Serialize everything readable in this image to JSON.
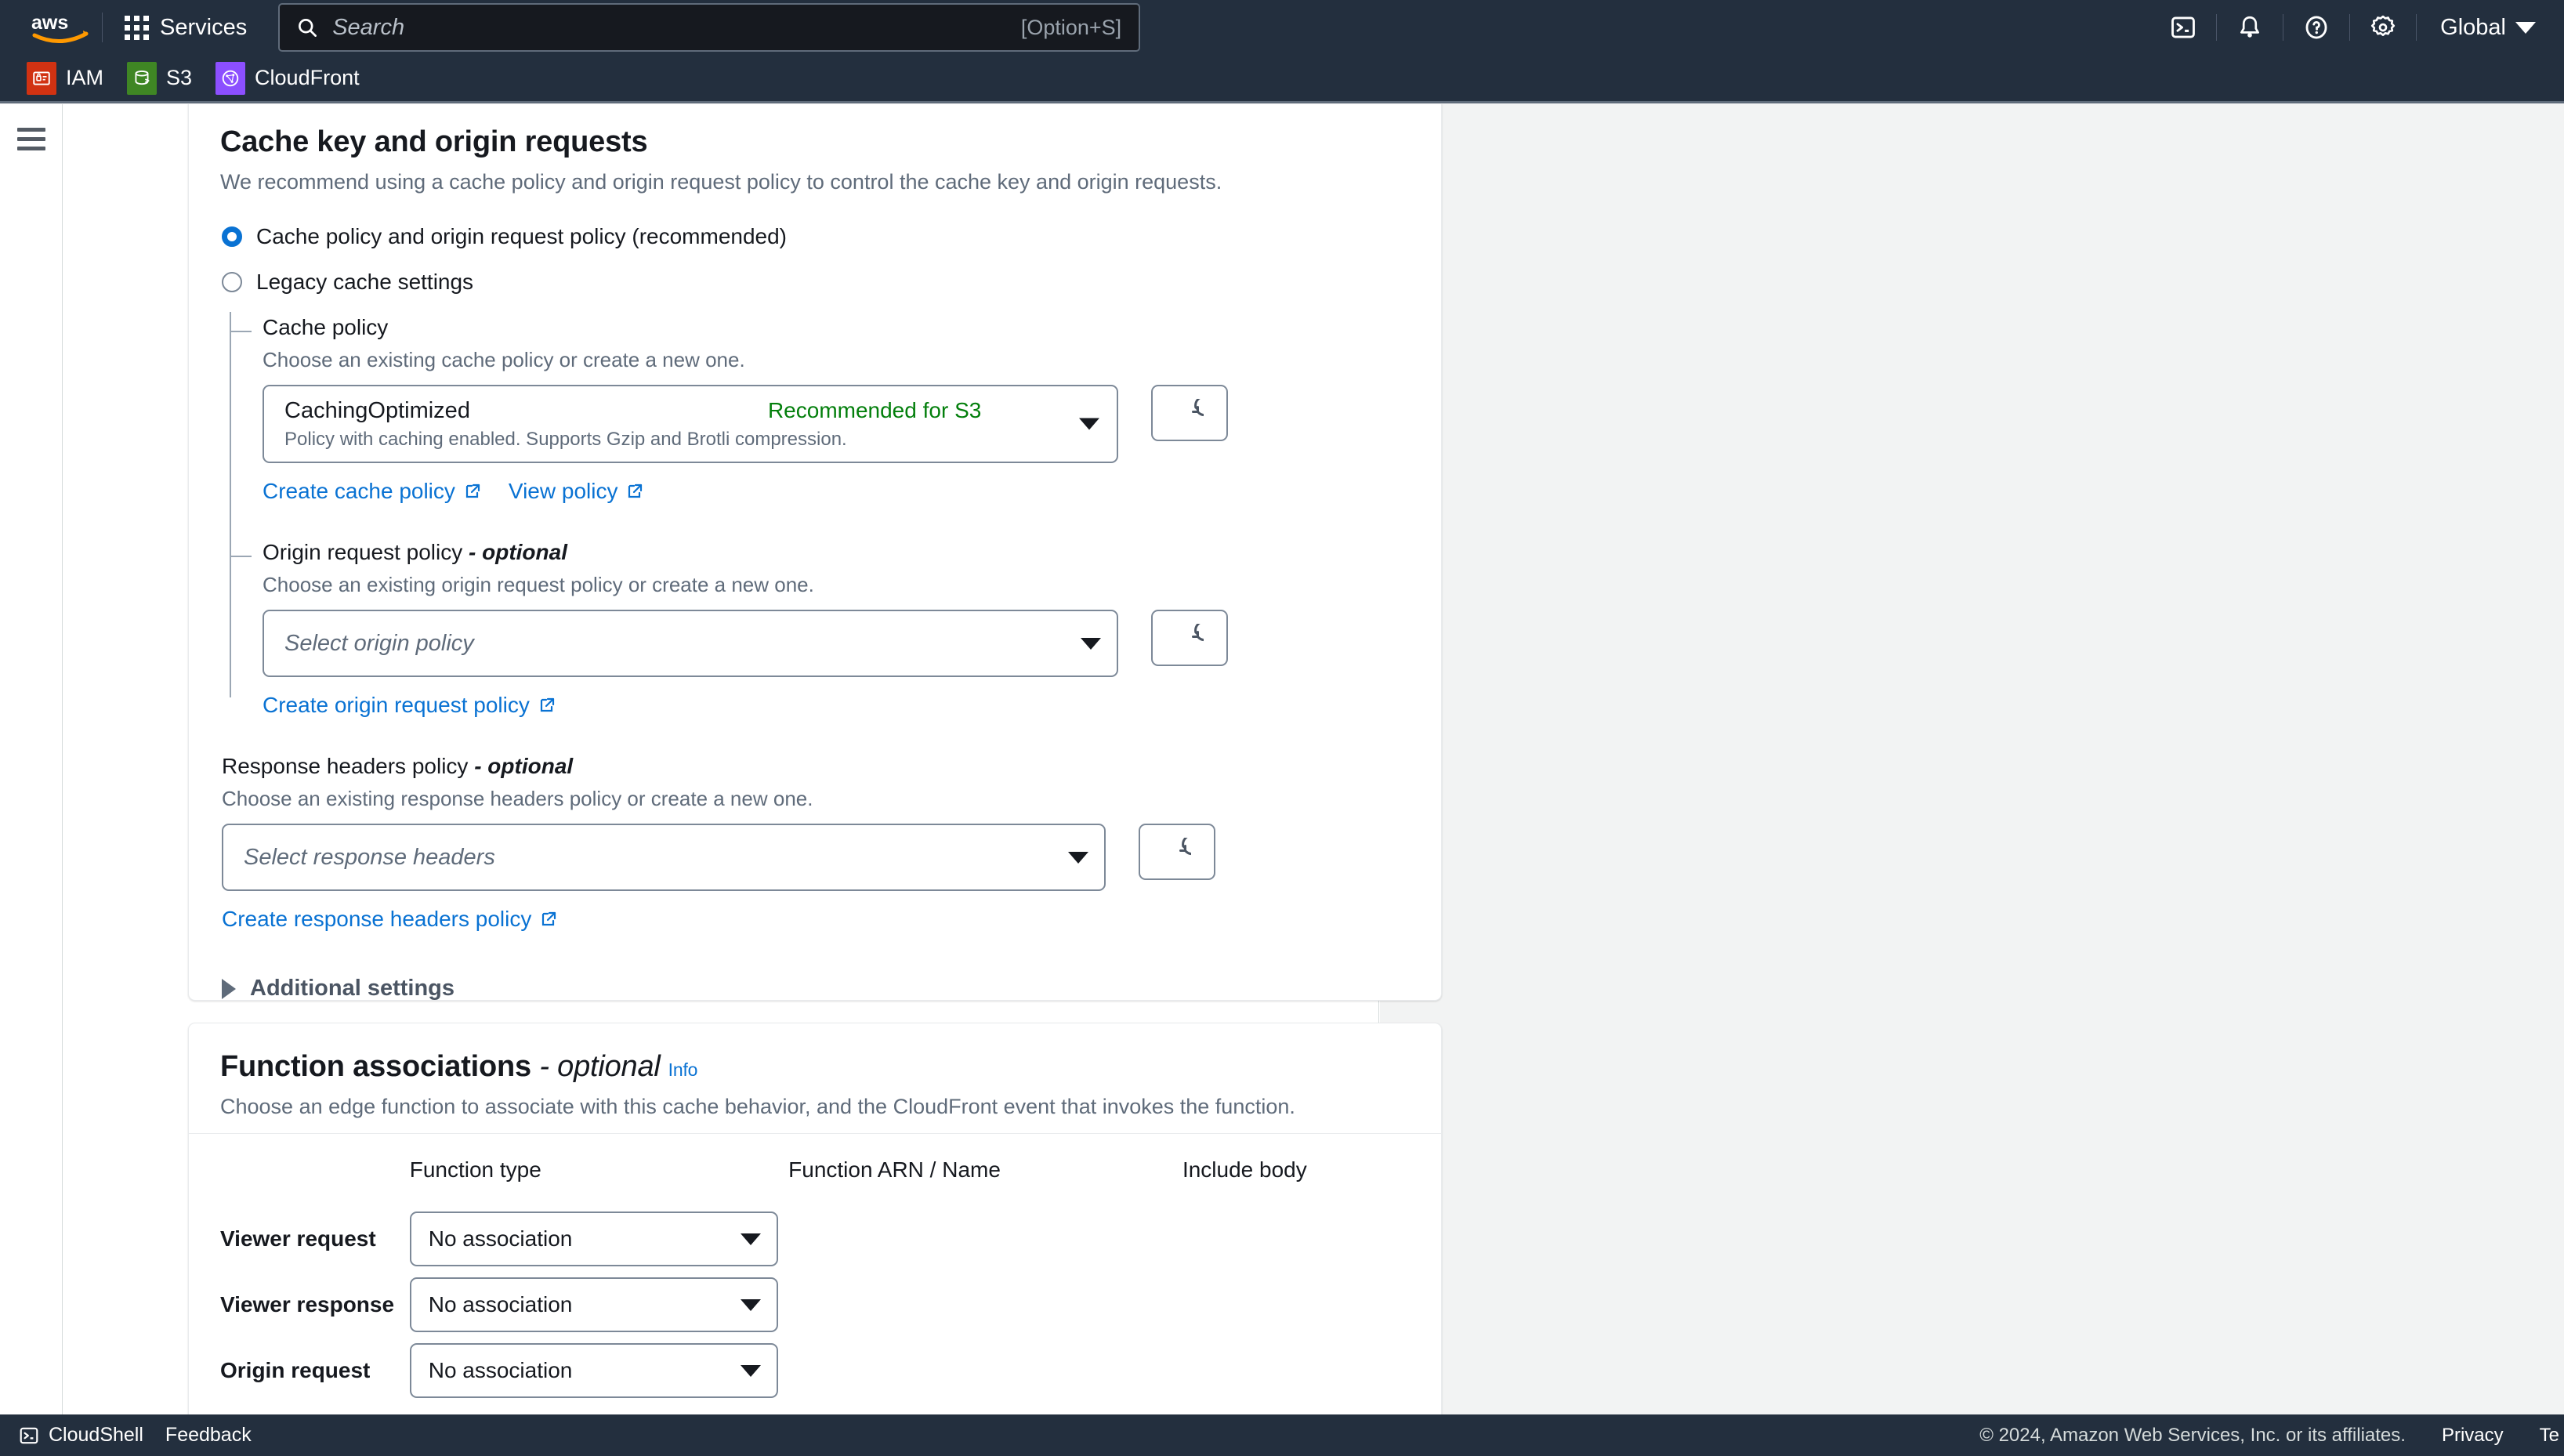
{
  "topnav": {
    "logo_alt": "aws",
    "services_label": "Services",
    "search_placeholder": "Search",
    "search_shortcut": "[Option+S]",
    "region_label": "Global",
    "icons": [
      "cloudshell-icon",
      "notifications-bell-icon",
      "help-question-icon",
      "settings-gear-icon"
    ]
  },
  "servicebar": {
    "services": [
      {
        "name": "IAM",
        "color": "#d13212"
      },
      {
        "name": "S3",
        "color": "#3f8624"
      },
      {
        "name": "CloudFront",
        "color": "#8c4fff"
      }
    ]
  },
  "cache_card": {
    "title": "Cache key and origin requests",
    "subtitle": "We recommend using a cache policy and origin request policy to control the cache key and origin requests.",
    "radios": [
      {
        "label": "Cache policy and origin request policy (recommended)",
        "checked": true
      },
      {
        "label": "Legacy cache settings",
        "checked": false
      }
    ],
    "cache_policy": {
      "label": "Cache policy",
      "description": "Choose an existing cache policy or create a new one.",
      "selected_name": "CachingOptimized",
      "selected_tag": "Recommended for S3",
      "selected_tag_color": "#037f0c",
      "selected_description": "Policy with caching enabled. Supports Gzip and Brotli compression.",
      "create_link": "Create cache policy",
      "view_link": "View policy",
      "refresh_label": "refresh-icon"
    },
    "origin_request_policy": {
      "label": "Origin request policy",
      "optional_suffix": "- optional",
      "description": "Choose an existing origin request policy or create a new one.",
      "placeholder": "Select origin policy",
      "create_link": "Create origin request policy",
      "refresh_label": "refresh-icon"
    },
    "response_headers_policy": {
      "label": "Response headers policy",
      "optional_suffix": "- optional",
      "description": "Choose an existing response headers policy or create a new one.",
      "placeholder": "Select response headers",
      "create_link": "Create response headers policy",
      "refresh_label": "refresh-icon"
    },
    "additional_settings_label": "Additional settings"
  },
  "function_card": {
    "title": "Function associations",
    "optional_suffix": "- optional",
    "info_label": "Info",
    "subtitle": "Choose an edge function to associate with this cache behavior, and the CloudFront event that invokes the function.",
    "headers": {
      "event": "",
      "type": "Function type",
      "arn": "Function ARN / Name",
      "body": "Include body"
    },
    "rows": [
      {
        "event": "Viewer request",
        "type": "No association",
        "arn": "",
        "body": ""
      },
      {
        "event": "Viewer response",
        "type": "No association",
        "arn": "",
        "body": ""
      },
      {
        "event": "Origin request",
        "type": "No association",
        "arn": "",
        "body": ""
      }
    ]
  },
  "footer": {
    "cloudshell": "CloudShell",
    "feedback": "Feedback",
    "copyright": "© 2024, Amazon Web Services, Inc. or its affiliates.",
    "privacy": "Privacy",
    "terms": "Te"
  }
}
